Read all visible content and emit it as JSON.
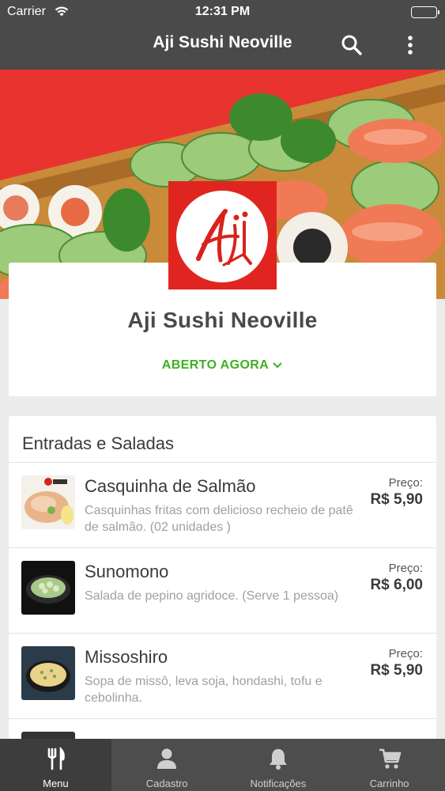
{
  "status_bar": {
    "carrier": "Carrier",
    "time": "12:31 PM"
  },
  "nav": {
    "title": "Aji Sushi Neoville",
    "actions": [
      "search-icon",
      "more-vertical-icon"
    ]
  },
  "restaurant": {
    "logo_text": "Aji",
    "name": "Aji Sushi Neoville",
    "status": "ABERTO AGORA",
    "brand_color": "#e02520",
    "status_color": "#3fb020"
  },
  "menu": {
    "section_title": "Entradas e Saladas",
    "items": [
      {
        "name": "Casquinha de Salmão",
        "description": "Casquinhas fritas com delicioso recheio de patê de salmão. (02 unidades )",
        "price_label": "Preço:",
        "price": "R$ 5,90"
      },
      {
        "name": "Sunomono",
        "description": "Salada de pepino agridoce.  (Serve 1 pessoa)",
        "price_label": "Preço:",
        "price": "R$ 6,00"
      },
      {
        "name": "Missoshiro",
        "description": "Sopa de missô, leva soja, hondashi, tofu e cebolinha.",
        "price_label": "Preço:",
        "price": "R$ 5,90"
      }
    ]
  },
  "tabs": [
    {
      "label": "Menu",
      "icon": "fork-knife-icon",
      "active": true
    },
    {
      "label": "Cadastro",
      "icon": "user-icon",
      "active": false
    },
    {
      "label": "Notificações",
      "icon": "bell-icon",
      "active": false
    },
    {
      "label": "Carrinho",
      "icon": "cart-icon",
      "active": false
    }
  ]
}
